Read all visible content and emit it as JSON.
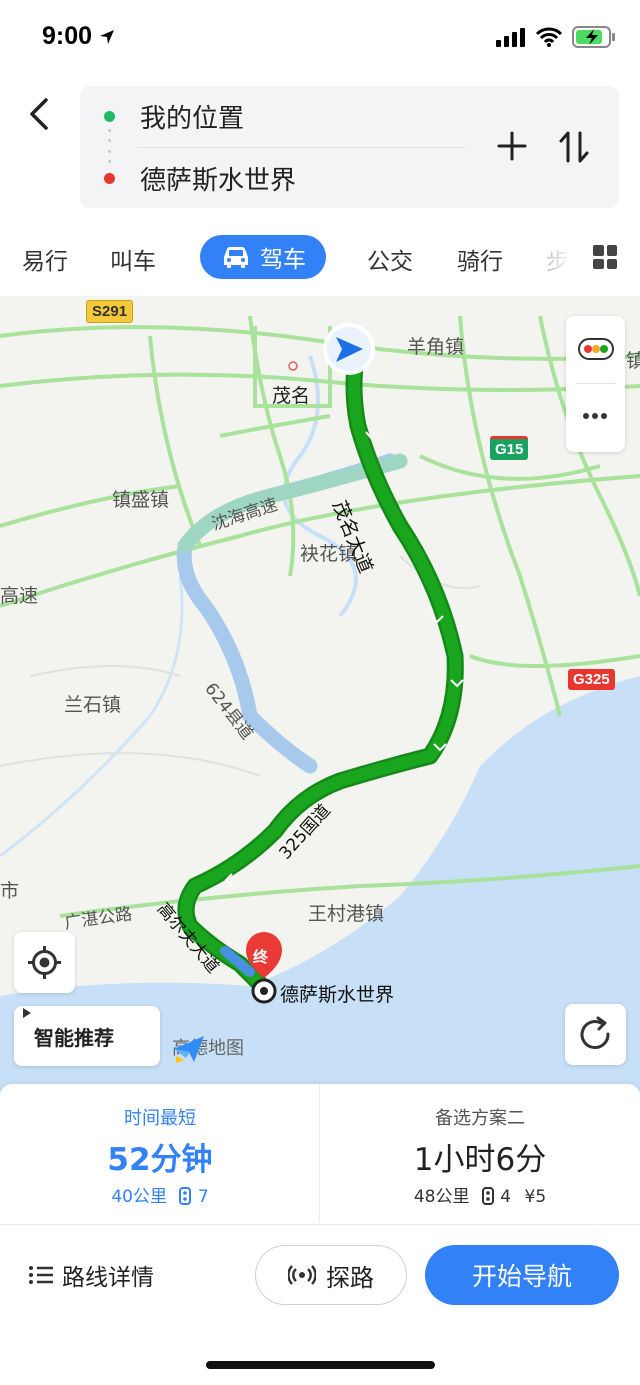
{
  "status_bar": {
    "time": "9:00"
  },
  "route": {
    "start": "我的位置",
    "end": "德萨斯水世界",
    "start_color": "#23b96b",
    "end_color": "#e8362f"
  },
  "modes": {
    "items": [
      "易行",
      "叫车",
      "驾车",
      "公交",
      "骑行",
      "步"
    ],
    "active": "驾车"
  },
  "map": {
    "shields": [
      "S291",
      "G15",
      "G325"
    ],
    "places": [
      "茂名",
      "羊角镇",
      "镇盛镇",
      "袂花镇",
      "兰石镇",
      "王村港镇",
      "高速",
      "市",
      "镇"
    ],
    "roads": [
      "沈海高速",
      "茂名大道",
      "624县道",
      "325国道",
      "高尔夫大道",
      "广湛公路"
    ],
    "destination": "德萨斯水世界",
    "destination_badge": "终",
    "smart_label": "智能推荐",
    "logo_text": "高德地图",
    "route_color": "#1aa51f",
    "alt_route_color": "#a6c9ec"
  },
  "routes": [
    {
      "tag": "时间最短",
      "time": "52分钟",
      "distance": "40公里",
      "lights": "7",
      "active": true
    },
    {
      "tag": "备选方案二",
      "time": "1小时6分",
      "distance": "48公里",
      "lights": "4",
      "toll": "¥5",
      "active": false
    }
  ],
  "bottom": {
    "details": "路线详情",
    "probe": "探路",
    "start_nav": "开始导航"
  },
  "accent": "#3281f7"
}
